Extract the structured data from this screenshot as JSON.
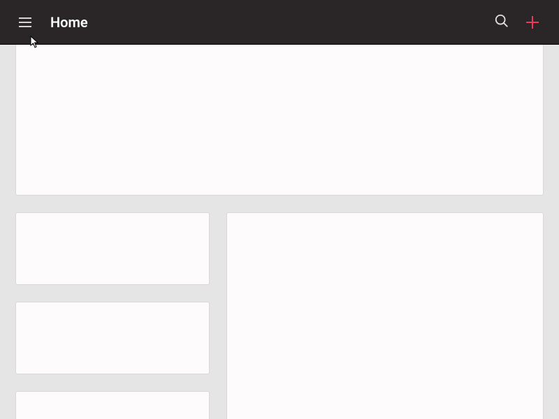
{
  "header": {
    "title": "Home"
  },
  "icons": {
    "menu": "menu",
    "search": "search",
    "add": "plus"
  },
  "colors": {
    "accent": "#f2385a",
    "topbar_bg": "#2a2627",
    "page_bg": "#e5e5e5",
    "card_bg": "#fdfbfc"
  }
}
